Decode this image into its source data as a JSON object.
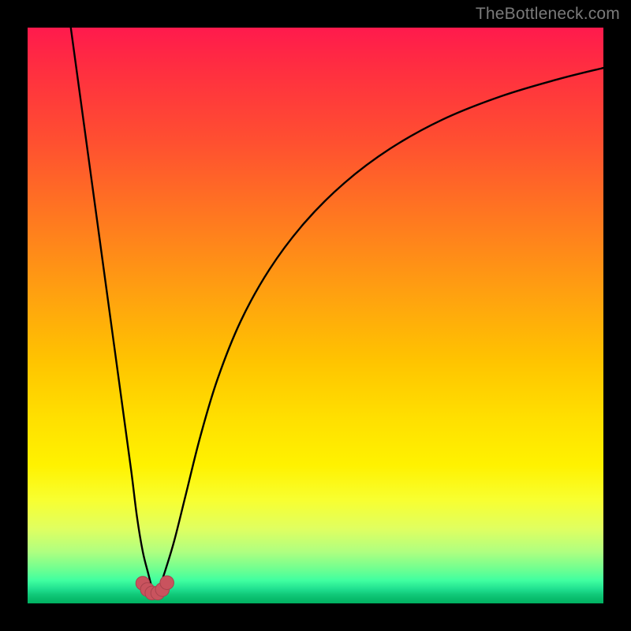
{
  "watermark": {
    "text": "TheBottleneck.com"
  },
  "colors": {
    "frame": "#000000",
    "curve": "#000000",
    "marker_fill": "#c9535e",
    "marker_stroke": "#a8434d"
  },
  "chart_data": {
    "type": "line",
    "title": "",
    "xlabel": "",
    "ylabel": "",
    "xlim": [
      0,
      100
    ],
    "ylim": [
      0,
      100
    ],
    "note": "Plot has no visible tick labels; x and y are normalized to 0–100 (percent of plot width/height). y=0 is bottom (green), y=100 is top (red). Two curves descend to a common trough near x≈22, y≈2 then the right branch rises toward the upper-right.",
    "series": [
      {
        "name": "left-branch",
        "x": [
          7.5,
          9,
          10.5,
          12,
          13.5,
          15,
          16.5,
          18,
          19,
          20,
          21,
          21.5
        ],
        "y": [
          100,
          89,
          78,
          67,
          56,
          45,
          34,
          23,
          15,
          9,
          5,
          3
        ]
      },
      {
        "name": "right-branch",
        "x": [
          23,
          24,
          25.5,
          27.5,
          30,
          33,
          37,
          42,
          48,
          55,
          63,
          72,
          82,
          92,
          100
        ],
        "y": [
          3,
          6,
          11,
          19,
          29,
          39,
          49,
          58,
          66,
          73,
          79,
          84,
          88,
          91,
          93
        ]
      }
    ],
    "markers": {
      "name": "trough-markers",
      "points": [
        {
          "x": 20.0,
          "y": 3.5
        },
        {
          "x": 20.8,
          "y": 2.4
        },
        {
          "x": 21.6,
          "y": 1.8
        },
        {
          "x": 22.6,
          "y": 1.8
        },
        {
          "x": 23.4,
          "y": 2.4
        },
        {
          "x": 24.2,
          "y": 3.6
        }
      ],
      "radius_pct": 1.2
    }
  }
}
